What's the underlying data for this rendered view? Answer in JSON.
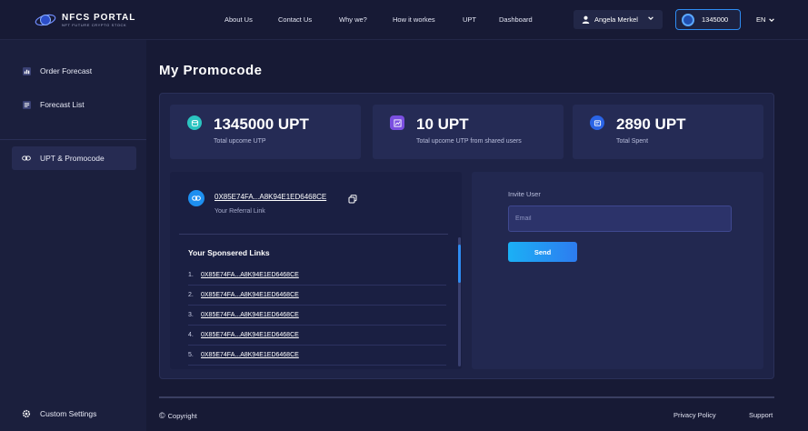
{
  "header": {
    "brand_title": "NFCS PORTAL",
    "brand_subtitle": "NFT FUTURE CRYPTO STOCK",
    "nav": [
      "About Us",
      "Contact Us",
      "Why we?",
      "How it workes",
      "UPT",
      "Dashboard"
    ],
    "user_name": "Angela Merkel",
    "balance": "1345000",
    "language": "EN"
  },
  "sidebar": {
    "items": [
      {
        "label": "Order Forecast",
        "icon": "bar-chart-icon"
      },
      {
        "label": "Forecast List",
        "icon": "list-icon"
      },
      {
        "label": "UPT & Promocode",
        "icon": "link-icon",
        "active": true
      }
    ],
    "settings_label": "Custom Settings"
  },
  "page": {
    "title": "My Promocode",
    "stats": [
      {
        "value": "1345000 UPT",
        "label": "Total upcome UTP",
        "color": "#2bc4c0"
      },
      {
        "value": "10 UPT",
        "label": "Total upcome UTP from shared users",
        "color": "#7a4fe0"
      },
      {
        "value": "2890 UPT",
        "label": "Total Spent",
        "color": "#2a64e6"
      }
    ],
    "referral": {
      "link": "0X85E74FA...A8K94E1ED6468CE",
      "label": "Your Referral Link"
    },
    "sponsored": {
      "title": "Your Sponsered Links",
      "links": [
        {
          "num": "1.",
          "addr": "0X85E74FA...A8K94E1ED6468CE"
        },
        {
          "num": "2.",
          "addr": "0X85E74FA...A8K94E1ED6468CE"
        },
        {
          "num": "3.",
          "addr": "0X85E74FA...A8K94E1ED6468CE"
        },
        {
          "num": "4.",
          "addr": "0X85E74FA...A8K94E1ED6468CE"
        },
        {
          "num": "5.",
          "addr": "0X85E74FA...A8K94E1ED6468CE"
        }
      ]
    },
    "invite": {
      "label": "Invite User",
      "email_placeholder": "Email",
      "send_label": "Send"
    }
  },
  "footer": {
    "copyright": "Copyright",
    "privacy": "Privacy Policy",
    "support": "Support"
  }
}
